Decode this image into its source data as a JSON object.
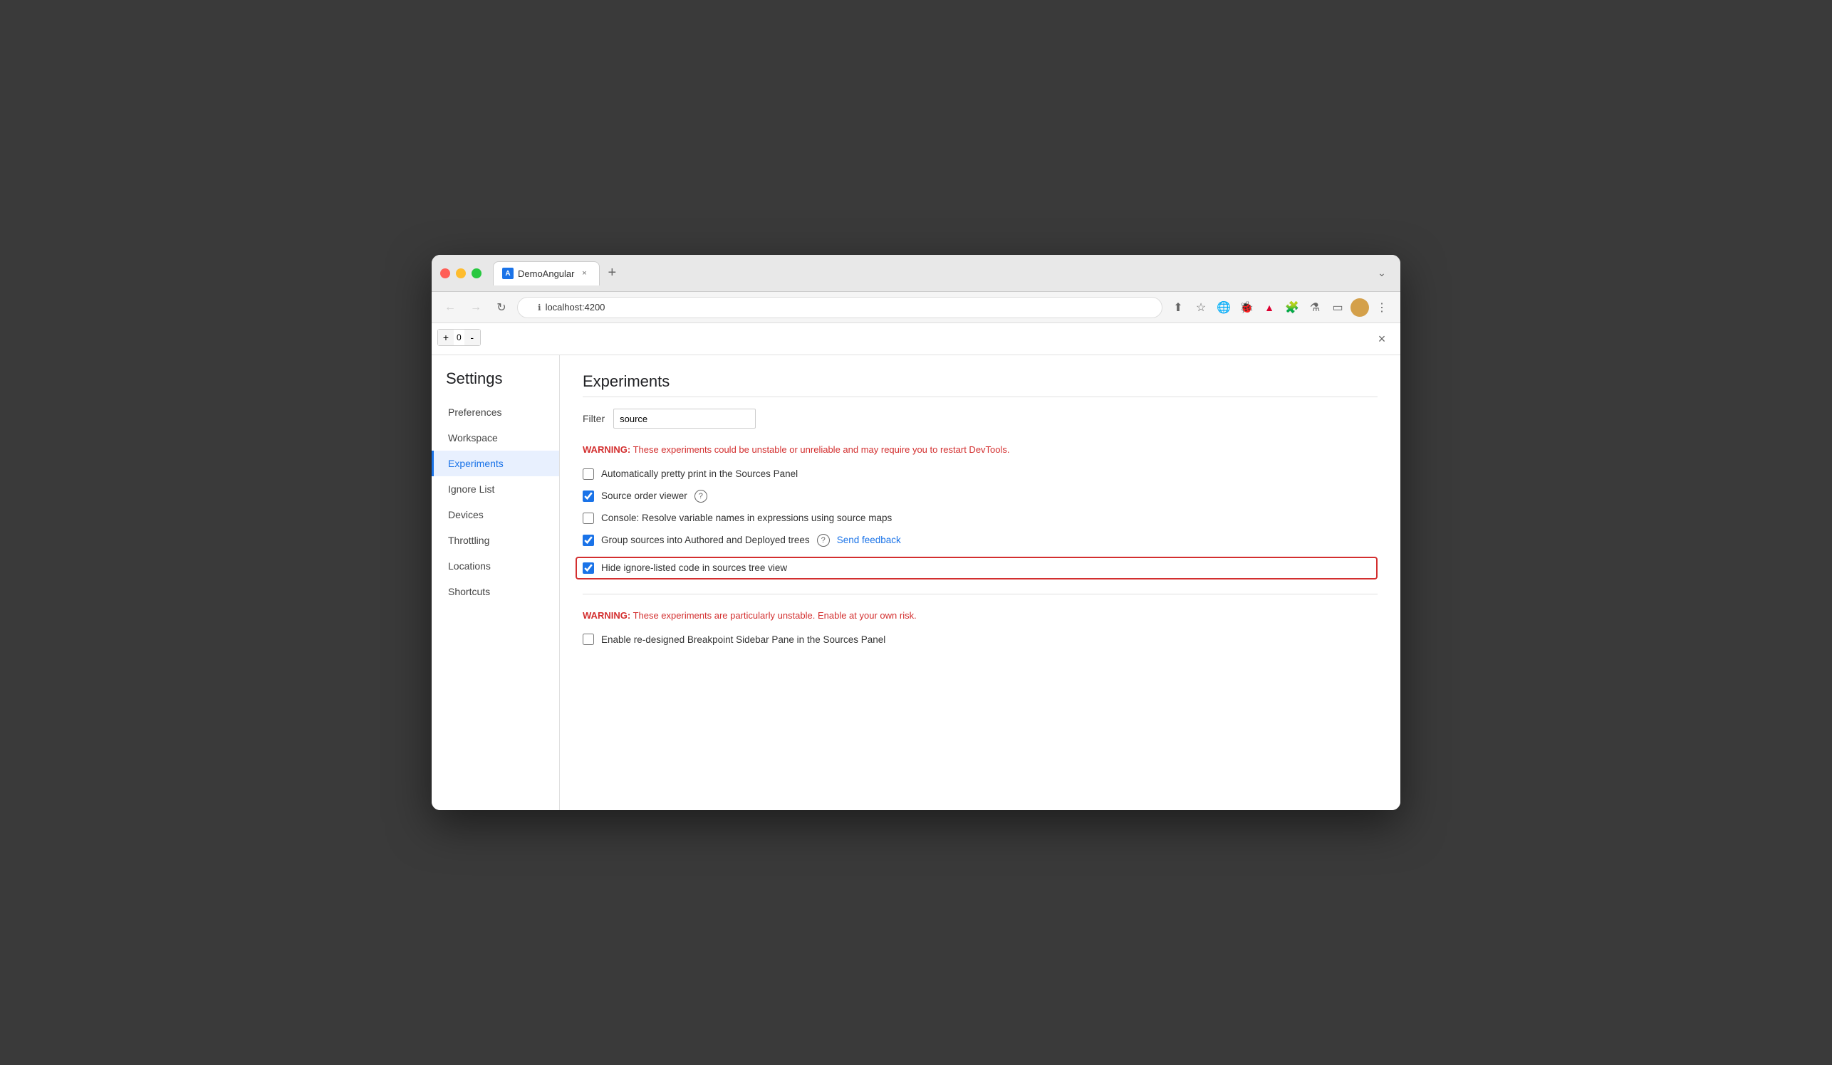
{
  "browser": {
    "tab_title": "DemoAngular",
    "tab_favicon_letter": "A",
    "tab_close_symbol": "×",
    "tab_new_symbol": "+",
    "address_url": "localhost:4200",
    "nav_back": "←",
    "nav_forward": "→",
    "nav_reload": "↻",
    "chevron_down": "⌄",
    "toolbar_icons": [
      "share",
      "star",
      "earth",
      "extensions-bug",
      "angular",
      "puzzle",
      "flask",
      "layout",
      "profile"
    ],
    "counter_minus": "-",
    "counter_value": "0",
    "counter_plus": "+"
  },
  "settings": {
    "title": "Settings",
    "close_symbol": "×",
    "nav_items": [
      {
        "id": "preferences",
        "label": "Preferences",
        "active": false
      },
      {
        "id": "workspace",
        "label": "Workspace",
        "active": false
      },
      {
        "id": "experiments",
        "label": "Experiments",
        "active": true
      },
      {
        "id": "ignore-list",
        "label": "Ignore List",
        "active": false
      },
      {
        "id": "devices",
        "label": "Devices",
        "active": false
      },
      {
        "id": "throttling",
        "label": "Throttling",
        "active": false
      },
      {
        "id": "locations",
        "label": "Locations",
        "active": false
      },
      {
        "id": "shortcuts",
        "label": "Shortcuts",
        "active": false
      }
    ],
    "section_title": "Experiments",
    "filter_label": "Filter",
    "filter_value": "source",
    "warning_1_label": "WARNING:",
    "warning_1_text": " These experiments could be unstable or unreliable and may require you to restart DevTools.",
    "experiments": [
      {
        "id": "pretty-print",
        "label": "Automatically pretty print in the Sources Panel",
        "checked": false,
        "highlighted": false,
        "has_help": false,
        "has_feedback": false
      },
      {
        "id": "source-order",
        "label": "Source order viewer",
        "checked": true,
        "highlighted": false,
        "has_help": true,
        "has_feedback": false
      },
      {
        "id": "console-resolve",
        "label": "Console: Resolve variable names in expressions using source maps",
        "checked": false,
        "highlighted": false,
        "has_help": false,
        "has_feedback": false
      },
      {
        "id": "group-sources",
        "label": "Group sources into Authored and Deployed trees",
        "checked": true,
        "highlighted": false,
        "has_help": true,
        "has_feedback": true,
        "feedback_text": "Send feedback"
      },
      {
        "id": "hide-ignore",
        "label": "Hide ignore-listed code in sources tree view",
        "checked": true,
        "highlighted": true,
        "has_help": false,
        "has_feedback": false
      }
    ],
    "warning_2_label": "WARNING:",
    "warning_2_text": " These experiments are particularly unstable. Enable at your own risk.",
    "unstable_experiments": [
      {
        "id": "breakpoint-sidebar",
        "label": "Enable re-designed Breakpoint Sidebar Pane in the Sources Panel",
        "checked": false,
        "highlighted": false
      }
    ],
    "help_symbol": "?",
    "colors": {
      "warning": "#d32f2f",
      "active_nav": "#1a73e8",
      "link": "#1a73e8",
      "checkbox_accent": "#1a73e8"
    }
  }
}
